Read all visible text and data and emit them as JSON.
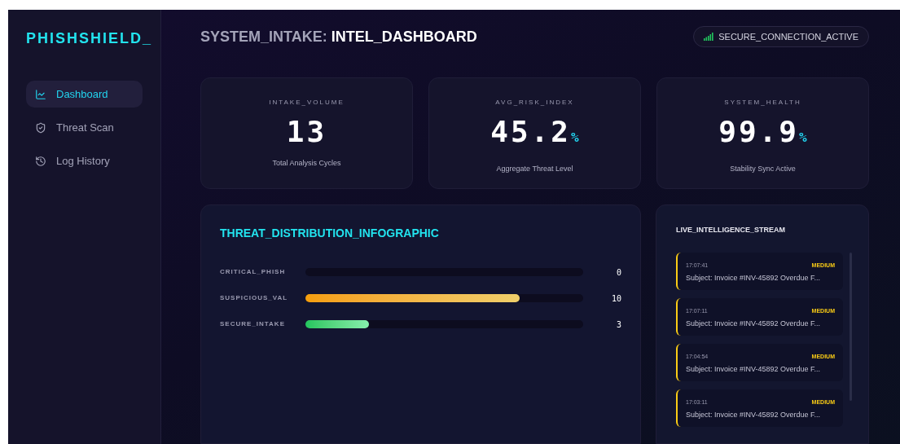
{
  "sidebar": {
    "logo": "PHISHSHIELD_",
    "items": [
      {
        "label": "Dashboard",
        "selected": true
      },
      {
        "label": "Threat Scan",
        "selected": false
      },
      {
        "label": "Log History",
        "selected": false
      }
    ]
  },
  "header": {
    "title_prefix": "SYSTEM_INTAKE:",
    "title": "INTEL_DASHBOARD",
    "status": "SECURE_CONNECTION_ACTIVE"
  },
  "stats": [
    {
      "label": "INTAKE_VOLUME",
      "value": "13",
      "caption": "Total Analysis Cycles"
    },
    {
      "label": "AVG_RISK_INDEX",
      "value": "45.2",
      "unit": "%",
      "caption": "Aggregate Threat Level"
    },
    {
      "label": "SYSTEM_HEALTH",
      "value": "99.9",
      "unit": "%",
      "caption": "Stability Sync Active"
    }
  ],
  "distribution": {
    "title": "THREAT_DISTRIBUTION_INFOGRAPHIC",
    "rows": [
      {
        "label": "CRITICAL_PHISH",
        "count": "0"
      },
      {
        "label": "SUSPICIOUS_VAL",
        "level": 0.77,
        "count": "10"
      },
      {
        "label": "SECURE_INTAKE",
        "level": 0.23,
        "count": "3"
      }
    ]
  },
  "stream": {
    "title": "LIVE_INTELLIGENCE_STREAM",
    "items": [
      {
        "time": "17:07:41",
        "severity": "MEDIUM",
        "subject": "Subject: Invoice #INV-45892 Overdue F...",
        "color": "#facc15"
      },
      {
        "time": "17:07:11",
        "severity": "MEDIUM",
        "subject": "Subject: Invoice #INV-45892 Overdue F...",
        "color": "#facc15"
      },
      {
        "time": "17:04:54",
        "severity": "MEDIUM",
        "subject": "Subject: Invoice #INV-45892 Overdue F...",
        "color": "#facc15"
      },
      {
        "time": "17:03:11",
        "severity": "MEDIUM",
        "subject": "Subject: Invoice #INV-45892 Overdue F...",
        "color": "#facc15"
      }
    ]
  }
}
